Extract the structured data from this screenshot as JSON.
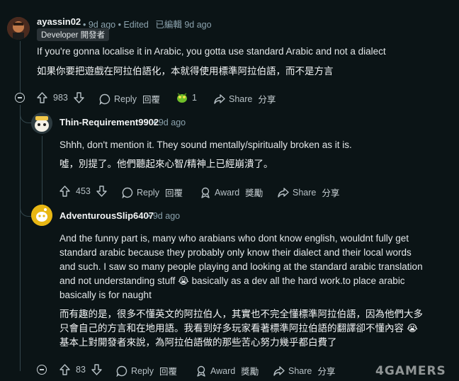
{
  "comments": [
    {
      "username": "ayassin02",
      "time": "9d ago",
      "edited": "Edited",
      "edited_zh": "已編輯 9d ago",
      "flair": "Developer 開發者",
      "body_en": "If you're gonna localise it in Arabic, you gotta use standard Arabic and not a dialect",
      "body_zh": "如果你要把遊戲在阿拉伯語化，本就得使用標準阿拉伯語，而不是方言",
      "votes": "983",
      "reply": "Reply",
      "reply_zh": "回覆",
      "award_count": "1",
      "share": "Share",
      "share_zh": "分享"
    },
    {
      "username": "Thin-Requirement9902",
      "time": "9d ago",
      "body_en": "Shhh, don't mention it. They sound mentally/spiritually broken as it is.",
      "body_zh": "噓，別提了。他們聽起來心智/精神上已經崩潰了。",
      "votes": "453",
      "reply": "Reply",
      "reply_zh": "回覆",
      "award": "Award",
      "award_zh": "獎勵",
      "share": "Share",
      "share_zh": "分享"
    },
    {
      "username": "AdventurousSlip6407",
      "time": "9d ago",
      "body_en_lines": [
        "And the funny part is, many who arabians who dont know english, wouldnt fully get",
        "standard arabic because they probably only know their dialect and their local words",
        "and such. I saw so many people playing and looking at the standard arabic translation",
        "and not understanding stuff 😭 basically as a dev all the hard work.to place arabic",
        "basically is for naught"
      ],
      "body_zh_lines": [
        "而有趣的是，很多不懂英文的阿拉伯人，其實也不完全懂標準阿拉伯語，因為他們大多",
        "只會自己的方言和在地用語。我看到好多玩家看著標準阿拉伯語的翻譯卻不懂內容 😭",
        "基本上對開發者來說，為阿拉伯語做的那些苦心努力幾乎都白費了"
      ],
      "votes": "83",
      "reply": "Reply",
      "reply_zh": "回覆",
      "award": "Award",
      "award_zh": "獎勵",
      "share": "Share",
      "share_zh": "分享"
    }
  ],
  "watermark": "4GAMERS",
  "colors": {
    "background": "#0b1416",
    "text": "#d7dadc",
    "meta": "#8ba2ad",
    "thread_line": "#33464c"
  }
}
